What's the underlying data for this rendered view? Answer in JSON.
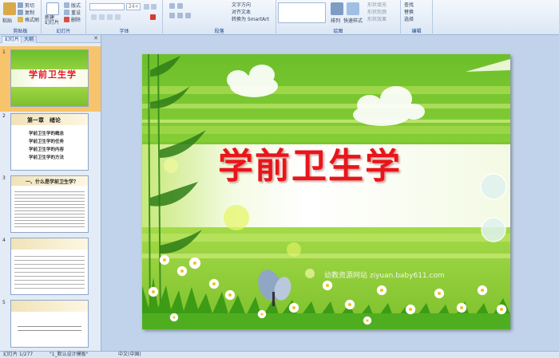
{
  "ribbon": {
    "clipboard": {
      "paste": "粘贴",
      "cut": "剪切",
      "copy": "复制",
      "format_painter": "格式刷",
      "label": "剪贴板"
    },
    "slides": {
      "new_slide": "新建\n幻灯片",
      "layout": "版式",
      "reset": "重设",
      "delete": "删除",
      "label": "幻灯片"
    },
    "font": {
      "size": "24+",
      "label": "字体"
    },
    "paragraph": {
      "text_direction": "文字方向",
      "align_text": "对齐文本",
      "smartart": "转换为 SmartArt",
      "label": "段落"
    },
    "drawing": {
      "arrange": "排列",
      "quick_styles": "快速样式",
      "shape_fill": "形状填充",
      "shape_outline": "形状轮廓",
      "shape_effects": "形状效果",
      "label": "绘图"
    },
    "editing": {
      "find": "查找",
      "replace": "替换",
      "select": "选择",
      "label": "编辑"
    }
  },
  "left_pane": {
    "tabs": [
      "幻灯片",
      "大纲"
    ],
    "thumbs": [
      {
        "num": "1",
        "title": "学前卫生学"
      },
      {
        "num": "2",
        "title": "第一章　绪论",
        "items": [
          "学前卫生学的概念",
          "学前卫生学的任务",
          "学前卫生学的内容",
          "学前卫生学的方法"
        ]
      },
      {
        "num": "3",
        "title": "一、什么是学前卫生学？"
      },
      {
        "num": "4"
      },
      {
        "num": "5"
      }
    ]
  },
  "slide": {
    "title": "学前卫生学",
    "watermark": "幼教资源网站  ziyuan.baby611.com"
  },
  "status": {
    "slide_count": "幻灯片 1/277",
    "theme": "\"1_默认设计模板\"",
    "language": "中文(中国)"
  },
  "colors": {
    "title_red": "#e8151b",
    "slide_green": "#7cc62e",
    "selection": "#f7c46b"
  }
}
